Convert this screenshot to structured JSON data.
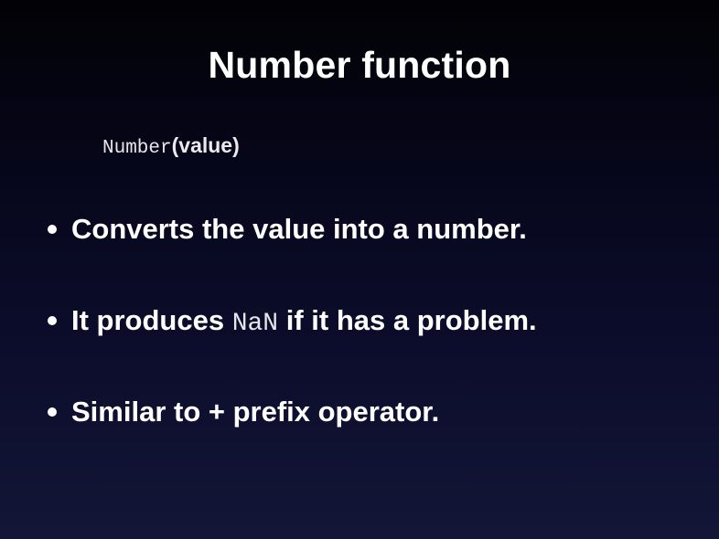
{
  "slide": {
    "title": "Number function",
    "signature": {
      "function_name": "Number",
      "parameters": "(value)"
    },
    "bullets": [
      {
        "text": "Converts the value into a number."
      },
      {
        "before": "It produces ",
        "code": "NaN",
        "after": " if it has a problem."
      },
      {
        "text": "Similar to + prefix operator."
      }
    ]
  }
}
